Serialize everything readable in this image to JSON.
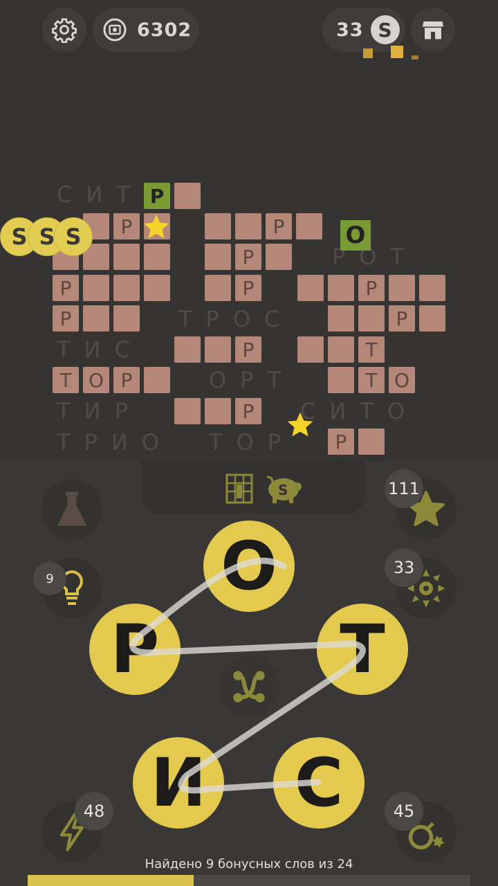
{
  "header": {
    "coins_value": "6302",
    "s_count": "33",
    "s_coin_letter": "S"
  },
  "board": {
    "ghost_words": [
      "СИТО",
      "РОТ",
      "ТРОС",
      "ТИС",
      "ОРТ",
      "ТИР",
      "СИТО",
      "ТРИО",
      "ТОР"
    ],
    "cell_letters": {
      "r1": "Р",
      "r2": "Р",
      "r3": "Р",
      "r4": "Р",
      "r5": "Р",
      "r6": "Р",
      "r7": "Р",
      "r8": "Р",
      "r9": "Р",
      "r10": "Р",
      "t1": "Т",
      "t2": "Т",
      "t3": "Т",
      "o1": "О",
      "o2": "О",
      "green_p": "Р",
      "green_o": "О"
    },
    "flying_coins": [
      "S",
      "S",
      "S"
    ]
  },
  "badges": {
    "hint": "9",
    "stars": "111",
    "burst": "33",
    "lightning": "48",
    "bomb": "45"
  },
  "wheel": {
    "letters": [
      "О",
      "Р",
      "Т",
      "И",
      "С"
    ]
  },
  "footer": {
    "status": "Найдено 9 бонусных слов из 24",
    "progress_fraction": 0.375
  },
  "colors": {
    "accent": "#e3ca4f",
    "tile": "#b58778",
    "found_tile": "#7a9a36"
  }
}
